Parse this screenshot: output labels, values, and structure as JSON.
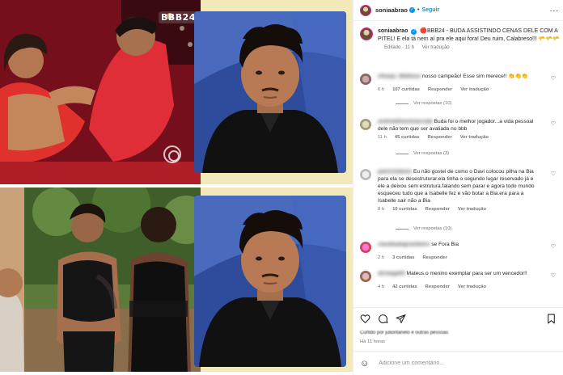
{
  "post": {
    "username": "soniaabrao",
    "follow_label": "Seguir",
    "more_label": "...",
    "caption_user": "soniaabrao",
    "caption_text": "🔴BBB24 - BUDA ASSISTINDO CENAS DELE COM A PITEL! E ela tá nem aí pra ele aqui fora! Deu ruim, Calabreso!!! 🫳🫳🫳",
    "caption_edited": "Editado · 11 h",
    "caption_translate": "Ver tradução",
    "bbb_logo": "BBB24",
    "liked_by": "Curtido por juliontanelo e outras pessoas",
    "time_ago": "Há 11 horas",
    "add_comment_placeholder": "Adicione um comentário..."
  },
  "comments": [
    {
      "user": "nilsaqs_Matheus",
      "text": "nosso campeão! Esse sim merece!! 👏👏👏",
      "time": "6 h",
      "likes": "107 curtidas",
      "reply": "Responder",
      "translate": "Ver tradução",
      "replies": "Ver respostas (10)"
    },
    {
      "user": "andreiafimentoarruda",
      "text": "Buda foi o melhor jogador...a vida pessoal dele não tem que ser avaliada no bbb",
      "time": "11 h",
      "likes": "45 curtidas",
      "reply": "Responder",
      "translate": "Ver tradução",
      "replies": "Ver respostas (3)"
    },
    {
      "user": "patriciolalves",
      "text": "Eu não gostei de como o Davi colocou pilha na Bia para ela se desestruturar.ela tinha o segundo lugar reservado já e ele a deixou sem estrutura.falando sem parar e agora todo mundo esqueceu tudo que a Isabelle fez e vão botar a Bia.era para a Isabelle sair não a Bia",
      "time": "8 h",
      "likes": "10 curtidas",
      "reply": "Responder",
      "translate": "Ver tradução",
      "replies": "Ver respostas (10)"
    },
    {
      "user": "claudiaalegriaribeiro",
      "text": "se Fora Bia",
      "time": "2 h",
      "likes": "3 curtidas",
      "reply": "Responder"
    },
    {
      "user": "alciaagdell",
      "text": "Mateus.o menino exemplar para ser um vencedor!!",
      "time": "4 h",
      "likes": "42 curtidas",
      "reply": "Responder",
      "translate": "Ver tradução"
    }
  ],
  "icons": {
    "like": "heart-icon",
    "comment": "comment-icon",
    "share": "share-icon",
    "save": "bookmark-icon",
    "emoji": "emoji-icon",
    "verified": "verified-badge-icon"
  },
  "colors": {
    "link_blue": "#0095f6",
    "text": "#262626",
    "muted": "#737373",
    "panel_yellow": "#f3e8b8"
  }
}
